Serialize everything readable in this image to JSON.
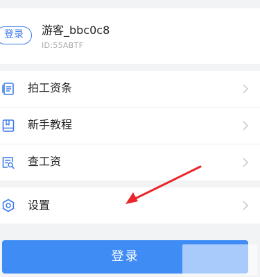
{
  "profile": {
    "login_badge": "登录",
    "username": "游客_bbc0c8",
    "user_id": "ID:55ABTF"
  },
  "menu": {
    "items": [
      {
        "label": "拍工资条",
        "icon": "document-icon"
      },
      {
        "label": "新手教程",
        "icon": "book-icon"
      },
      {
        "label": "查工资",
        "icon": "search-document-icon"
      }
    ]
  },
  "settings": {
    "label": "设置",
    "icon": "hexagon-settings-icon"
  },
  "login_button": {
    "label": "登录"
  },
  "colors": {
    "accent": "#3d7ce8",
    "button": "#3f8cf5",
    "arrow": "#e8262b",
    "background": "#f2f3f5"
  }
}
